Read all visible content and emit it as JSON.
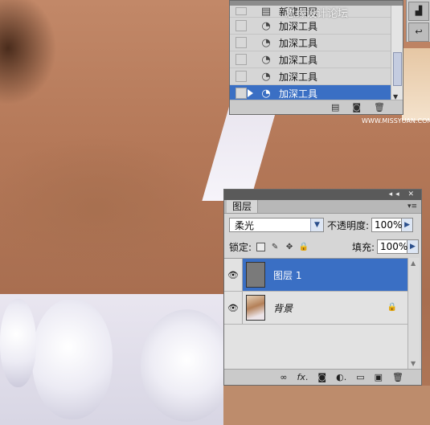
{
  "history_panel": {
    "partial_top_label": "新建图层",
    "items": [
      {
        "label": "加深工具",
        "icon": "burn-tool-icon",
        "selected": false
      },
      {
        "label": "加深工具",
        "icon": "burn-tool-icon",
        "selected": false
      },
      {
        "label": "加深工具",
        "icon": "burn-tool-icon",
        "selected": false
      },
      {
        "label": "加深工具",
        "icon": "burn-tool-icon",
        "selected": false
      },
      {
        "label": "加深工具",
        "icon": "burn-tool-icon",
        "selected": true
      }
    ]
  },
  "watermark": "思缘设计论坛",
  "watermark_url": "WWW.MISSYUAN.COM",
  "layers_panel": {
    "tab_label": "图层",
    "blend_mode": "柔光",
    "opacity_label": "不透明度:",
    "opacity_value": "100%",
    "lock_label": "锁定:",
    "fill_label": "填充:",
    "fill_value": "100%",
    "layers": [
      {
        "name": "图层 1",
        "selected": true,
        "visible": true
      },
      {
        "name": "背景",
        "selected": false,
        "visible": true,
        "locked": true
      }
    ]
  },
  "colors": {
    "selection": "#3a6fc4",
    "panel_bg": "#d6d6d6"
  }
}
